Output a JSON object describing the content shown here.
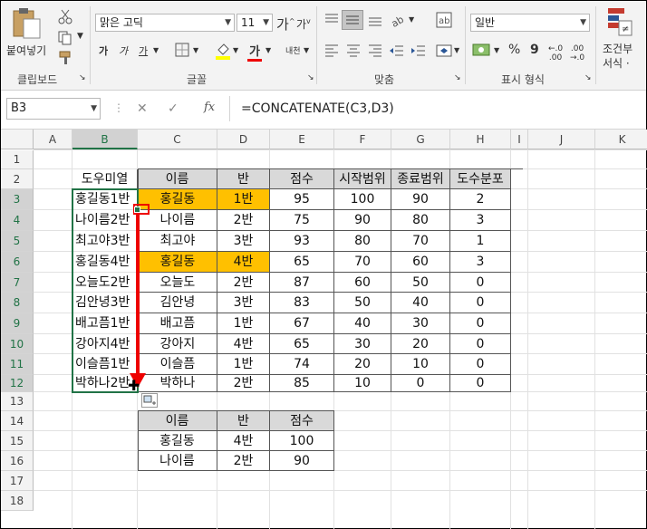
{
  "ribbon": {
    "paste_label": "붙여넣기",
    "clipboard_group": "클립보드",
    "font_name": "맑은 고딕",
    "font_size": "11",
    "font_group": "글꼴",
    "align_group": "맞춤",
    "number_format": "일반",
    "number_group": "표시 형식",
    "conditional_label_1": "조건부",
    "conditional_label_2": "서식 ·",
    "percent_symbol": "%",
    "comma_symbol": "9",
    "currency_symbol": "₩",
    "text_color_btn": "가",
    "bold_btn": "가",
    "italic_btn": "가",
    "underline_btn": "가",
    "grow_font": "가",
    "shrink_font": "가",
    "phonetic_btn": "내천",
    "accent_color": "#217346"
  },
  "formula_bar": {
    "name_box": "B3",
    "formula": "=CONCATENATE(C3,D3)",
    "cancel_symbol": "✕",
    "enter_symbol": "✓",
    "fx_symbol": "fx"
  },
  "columns": [
    "A",
    "B",
    "C",
    "D",
    "E",
    "F",
    "G",
    "H",
    "I",
    "J",
    "K"
  ],
  "rows": [
    "1",
    "2",
    "3",
    "4",
    "5",
    "6",
    "7",
    "8",
    "9",
    "10",
    "11",
    "12",
    "13",
    "14",
    "15",
    "16",
    "17",
    "18"
  ],
  "table1": {
    "headers": [
      "도우미열",
      "이름",
      "반",
      "점수",
      "시작범위",
      "종료범위",
      "도수분포"
    ],
    "rows": [
      [
        "홍길동1반",
        "홍길동",
        "1반",
        "95",
        "100",
        "90",
        "2"
      ],
      [
        "나이름2반",
        "나이름",
        "2반",
        "75",
        "90",
        "80",
        "3"
      ],
      [
        "최고야3반",
        "최고야",
        "3반",
        "93",
        "80",
        "70",
        "1"
      ],
      [
        "홍길동4반",
        "홍길동",
        "4반",
        "65",
        "70",
        "60",
        "3"
      ],
      [
        "오늘도2반",
        "오늘도",
        "2반",
        "87",
        "60",
        "50",
        "0"
      ],
      [
        "김안녕3반",
        "김안녕",
        "3반",
        "83",
        "50",
        "40",
        "0"
      ],
      [
        "배고픔1반",
        "배고픔",
        "1반",
        "67",
        "40",
        "30",
        "0"
      ],
      [
        "강아지4반",
        "강아지",
        "4반",
        "65",
        "30",
        "20",
        "0"
      ],
      [
        "이슬픔1반",
        "이슬픔",
        "1반",
        "74",
        "20",
        "10",
        "0"
      ],
      [
        "박하나2반",
        "박하나",
        "2반",
        "85",
        "10",
        "0",
        "0"
      ]
    ],
    "highlight_color": "#ffc000"
  },
  "table2": {
    "headers": [
      "이름",
      "반",
      "점수"
    ],
    "rows": [
      [
        "홍길동",
        "4반",
        "100"
      ],
      [
        "나이름",
        "2반",
        "90"
      ]
    ]
  }
}
